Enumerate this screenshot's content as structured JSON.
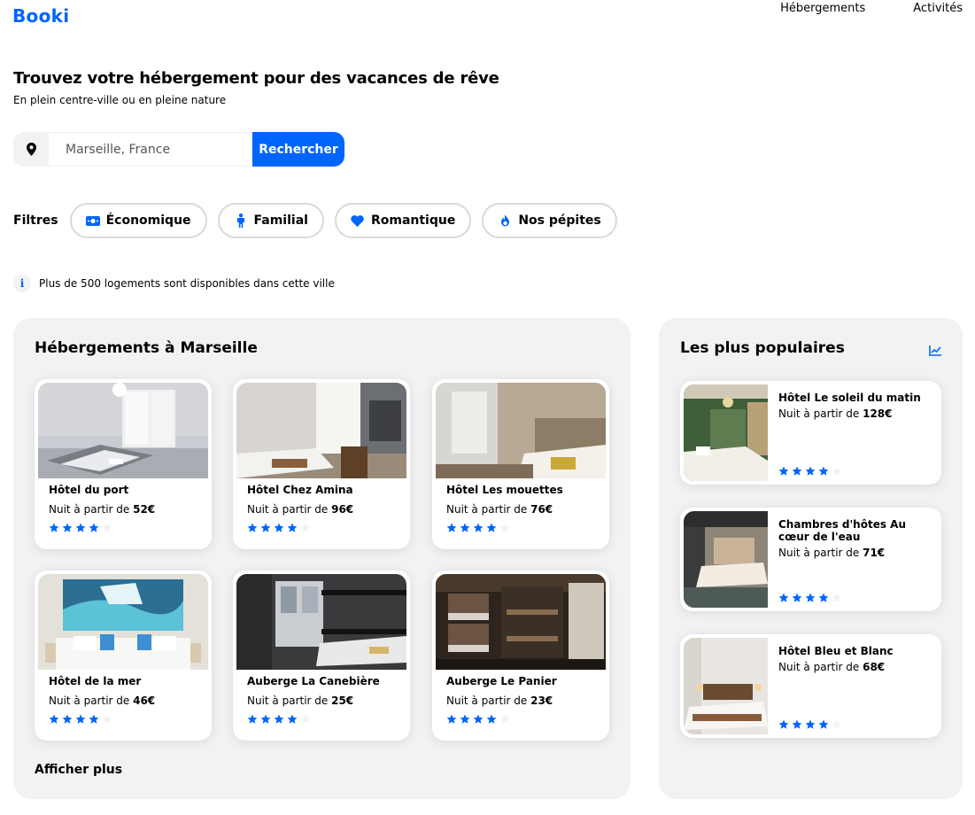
{
  "header": {
    "logo": "Booki",
    "nav": [
      "Hébergements",
      "Activités"
    ]
  },
  "hero": {
    "title": "Trouvez votre hébergement pour des vacances de rêve",
    "subtitle": "En plein centre-ville ou en pleine nature"
  },
  "search": {
    "icon": "map-pin-icon",
    "placeholder": "Marseille, France",
    "value": "",
    "button_label": "Rechercher"
  },
  "filters": {
    "label": "Filtres",
    "items": [
      {
        "label": "Économique",
        "icon": "money-bill-icon"
      },
      {
        "label": "Familial",
        "icon": "child-icon"
      },
      {
        "label": "Romantique",
        "icon": "heart-icon"
      },
      {
        "label": "Nos pépites",
        "icon": "fire-icon"
      }
    ]
  },
  "info": {
    "icon": "info-icon",
    "text": "Plus de 500 logements sont disponibles dans cette ville"
  },
  "hebergements": {
    "title": "Hébergements à Marseille",
    "price_prefix": "Nuit à partir de ",
    "more_label": "Afficher plus",
    "items": [
      {
        "name": "Hôtel du port",
        "price": "52€",
        "rating": 4
      },
      {
        "name": "Hôtel Chez Amina",
        "price": "96€",
        "rating": 4
      },
      {
        "name": "Hôtel Les mouettes",
        "price": "76€",
        "rating": 4
      },
      {
        "name": "Hôtel de la mer",
        "price": "46€",
        "rating": 4
      },
      {
        "name": "Auberge La Canebière",
        "price": "25€",
        "rating": 4
      },
      {
        "name": "Auberge Le Panier",
        "price": "23€",
        "rating": 4
      }
    ]
  },
  "populaires": {
    "title": "Les plus populaires",
    "icon": "chart-line-icon",
    "price_prefix": "Nuit à partir de ",
    "items": [
      {
        "name": "Hôtel Le soleil du matin",
        "price": "128€",
        "rating": 4
      },
      {
        "name": "Chambres d'hôtes Au cœur de l'eau",
        "price": "71€",
        "rating": 4
      },
      {
        "name": "Hôtel Bleu et Blanc",
        "price": "68€",
        "rating": 4
      }
    ]
  },
  "colors": {
    "primary": "#0065FC",
    "panel_bg": "#F2F2F2",
    "star_empty": "#F2F2F2"
  }
}
